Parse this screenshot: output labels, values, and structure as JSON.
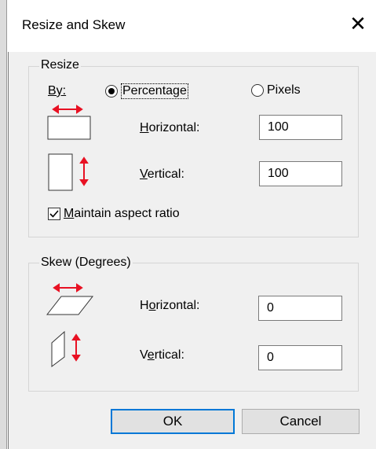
{
  "dialog": {
    "title": "Resize and Skew"
  },
  "resize": {
    "group_label": "Resize",
    "by_label": "By:",
    "options": [
      {
        "label": "Percentage",
        "selected": true
      },
      {
        "label": "Pixels",
        "selected": false
      }
    ],
    "horizontal": {
      "label_u": "H",
      "label_rest": "orizontal:",
      "value": "100"
    },
    "vertical": {
      "label_u": "V",
      "label_rest": "ertical:",
      "value": "100"
    },
    "maintain_aspect": {
      "label_u": "M",
      "label_rest": "aintain aspect ratio",
      "checked": true
    }
  },
  "skew": {
    "group_label": "Skew (Degrees)",
    "horizontal": {
      "label_pre": "H",
      "label_u": "o",
      "label_rest": "rizontal:",
      "value": "0"
    },
    "vertical": {
      "label_pre": "V",
      "label_u": "e",
      "label_rest": "rtical:",
      "value": "0"
    }
  },
  "buttons": {
    "ok": "OK",
    "cancel": "Cancel"
  },
  "colors": {
    "arrow": "#e81123",
    "accent": "#0078d7"
  }
}
